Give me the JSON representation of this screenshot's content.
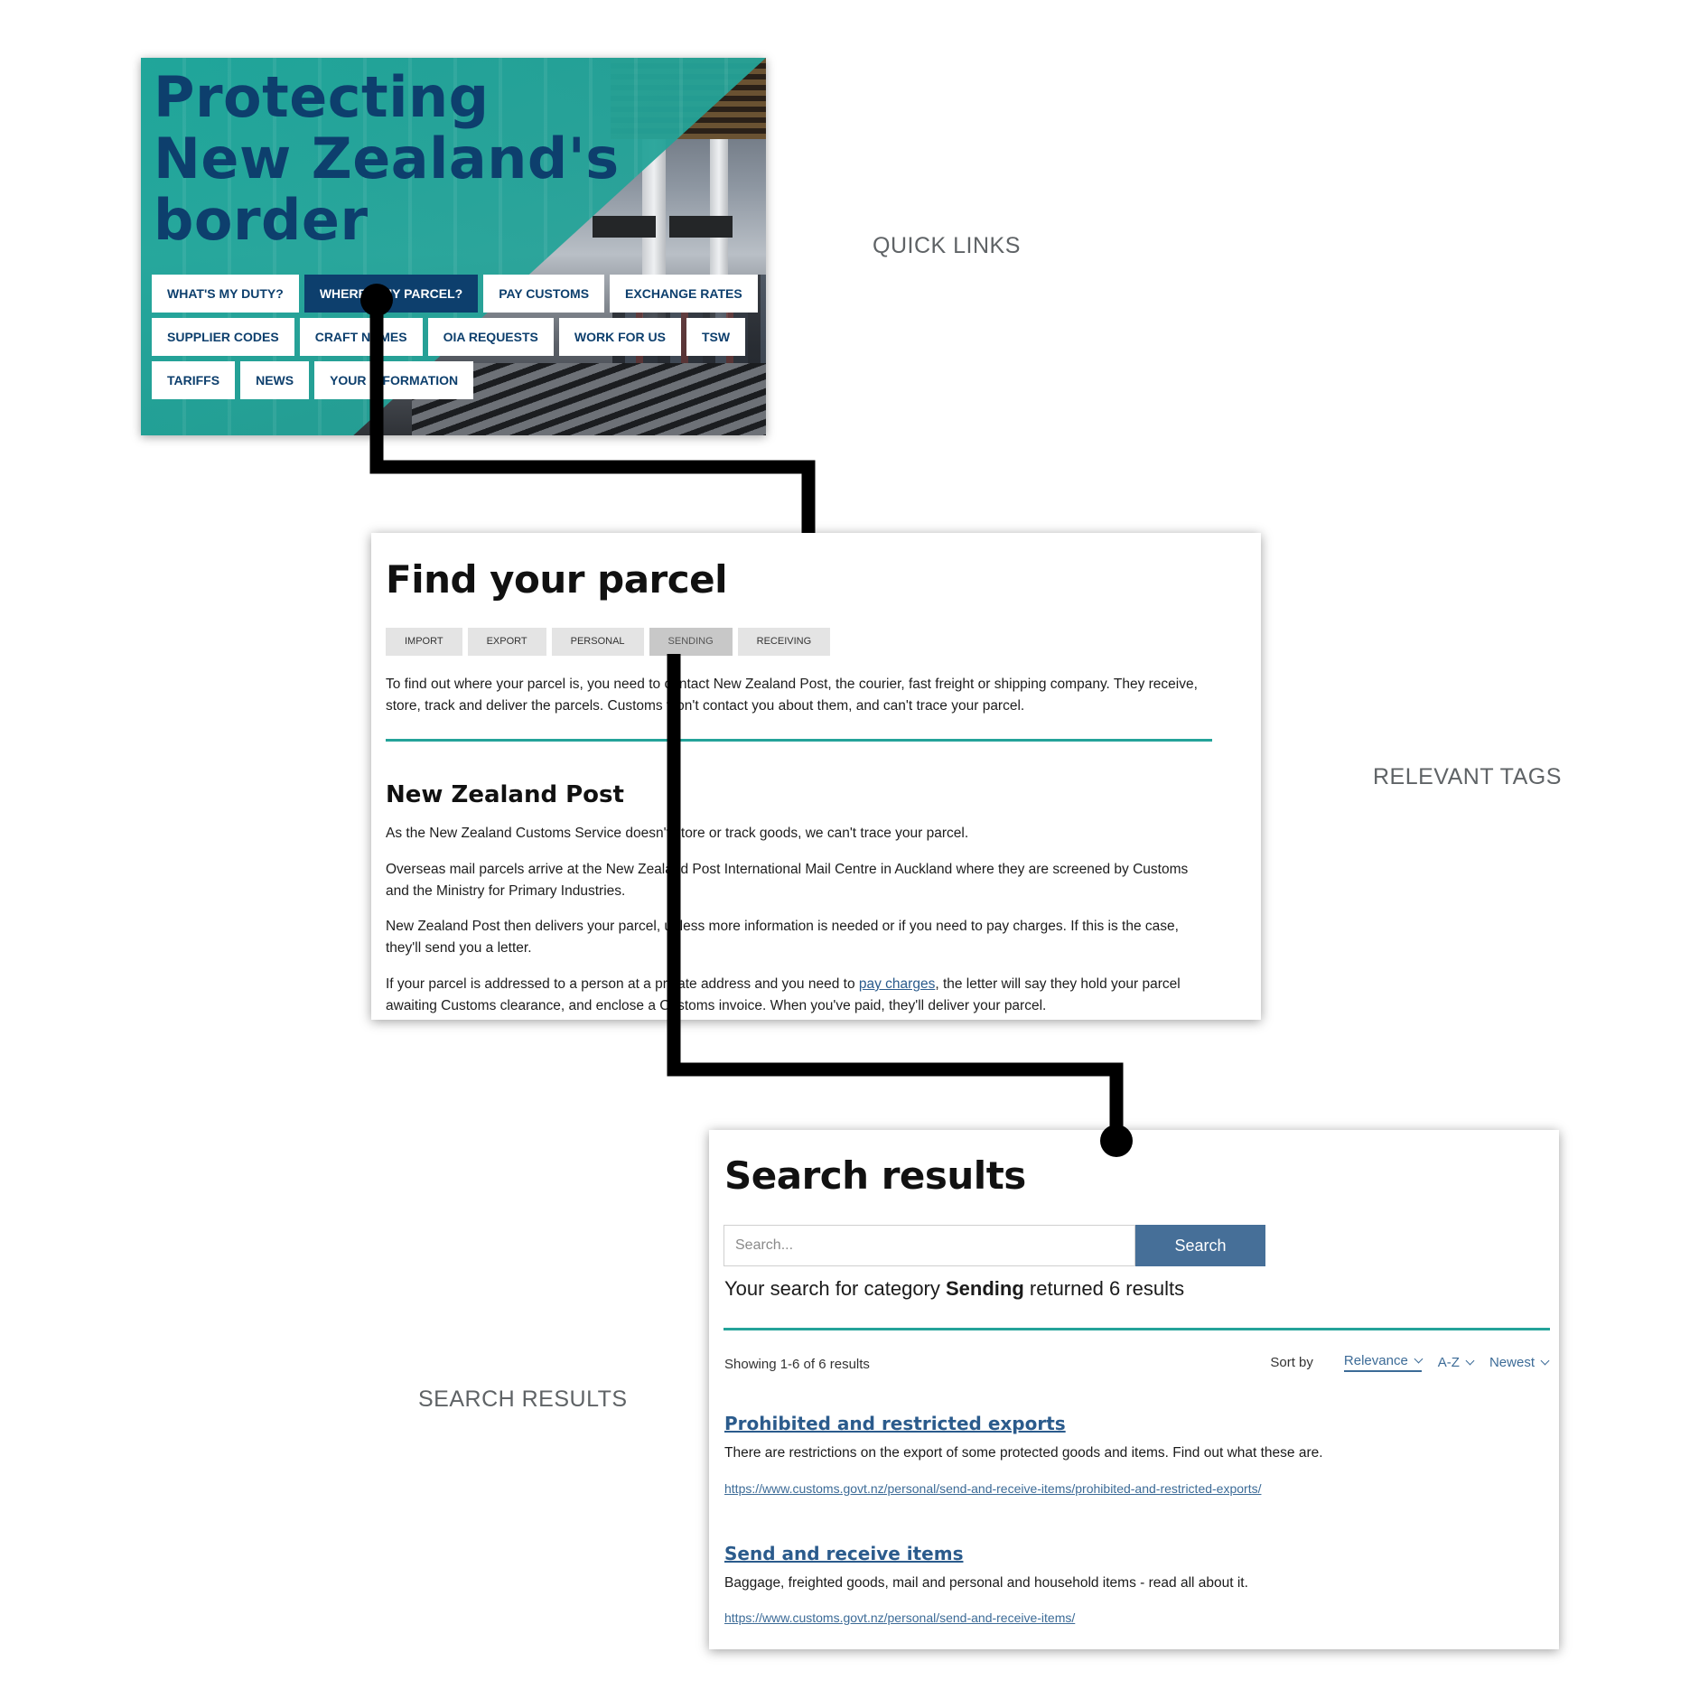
{
  "annotations": {
    "quick_links": "QUICK LINKS",
    "relevant_tags": "RELEVANT TAGS",
    "search_results": "SEARCH RESULTS"
  },
  "hero": {
    "title_lines": [
      "Protecting",
      "New Zealand's",
      "border"
    ],
    "quick_links": [
      [
        "WHAT'S MY DUTY?",
        "WHERE'S MY PARCEL?",
        "PAY CUSTOMS",
        "EXCHANGE RATES"
      ],
      [
        "SUPPLIER CODES",
        "CRAFT NAMES",
        "OIA REQUESTS",
        "WORK FOR US",
        "TSW"
      ],
      [
        "TARIFFS",
        "NEWS",
        "YOUR INFORMATION"
      ]
    ],
    "active_link": "WHERE'S MY PARCEL?"
  },
  "parcel": {
    "title": "Find your parcel",
    "tags": [
      "IMPORT",
      "EXPORT",
      "PERSONAL",
      "SENDING",
      "RECEIVING"
    ],
    "active_tag": "SENDING",
    "intro": "To find out where your parcel is, you need to contact New Zealand Post, the courier, fast freight or shipping company. They receive, store, track and deliver the parcels. Customs won't contact you about them, and can't trace your parcel.",
    "section_title": "New Zealand Post",
    "para1": "As the New Zealand Customs Service doesn't store or track goods, we can't trace your parcel.",
    "para2": "Overseas mail parcels arrive at the New Zealand Post International Mail Centre in Auckland where they are screened by Customs and the Ministry for Primary Industries.",
    "para3": "New Zealand Post then delivers your parcel, unless more information is needed or if you need to pay charges. If this is the case, they'll send you a letter.",
    "para4_before": "If your parcel is addressed to a person at a private address and you need to ",
    "para4_link": "pay charges",
    "para4_after": ", the letter will say they hold your parcel awaiting Customs clearance, and enclose a Customs invoice. When you've paid, they'll deliver your parcel."
  },
  "results": {
    "title": "Search results",
    "search_placeholder": "Search...",
    "search_button": "Search",
    "summary_before": "Your search for category ",
    "summary_category": "Sending",
    "summary_after": " returned 6 results",
    "showing": "Showing 1-6 of 6 results",
    "sort_label": "Sort by",
    "sort_options": [
      "Relevance",
      "A-Z",
      "Newest"
    ],
    "items": [
      {
        "title": "Prohibited and restricted exports",
        "desc": "There are restrictions on the export of some protected goods and items. Find out what these are.",
        "url": "https://www.customs.govt.nz/personal/send-and-receive-items/prohibited-and-restricted-exports/"
      },
      {
        "title": "Send and receive items",
        "desc": "Baggage, freighted goods, mail and personal and household items - read all about it.",
        "url": "https://www.customs.govt.nz/personal/send-and-receive-items/"
      }
    ]
  }
}
